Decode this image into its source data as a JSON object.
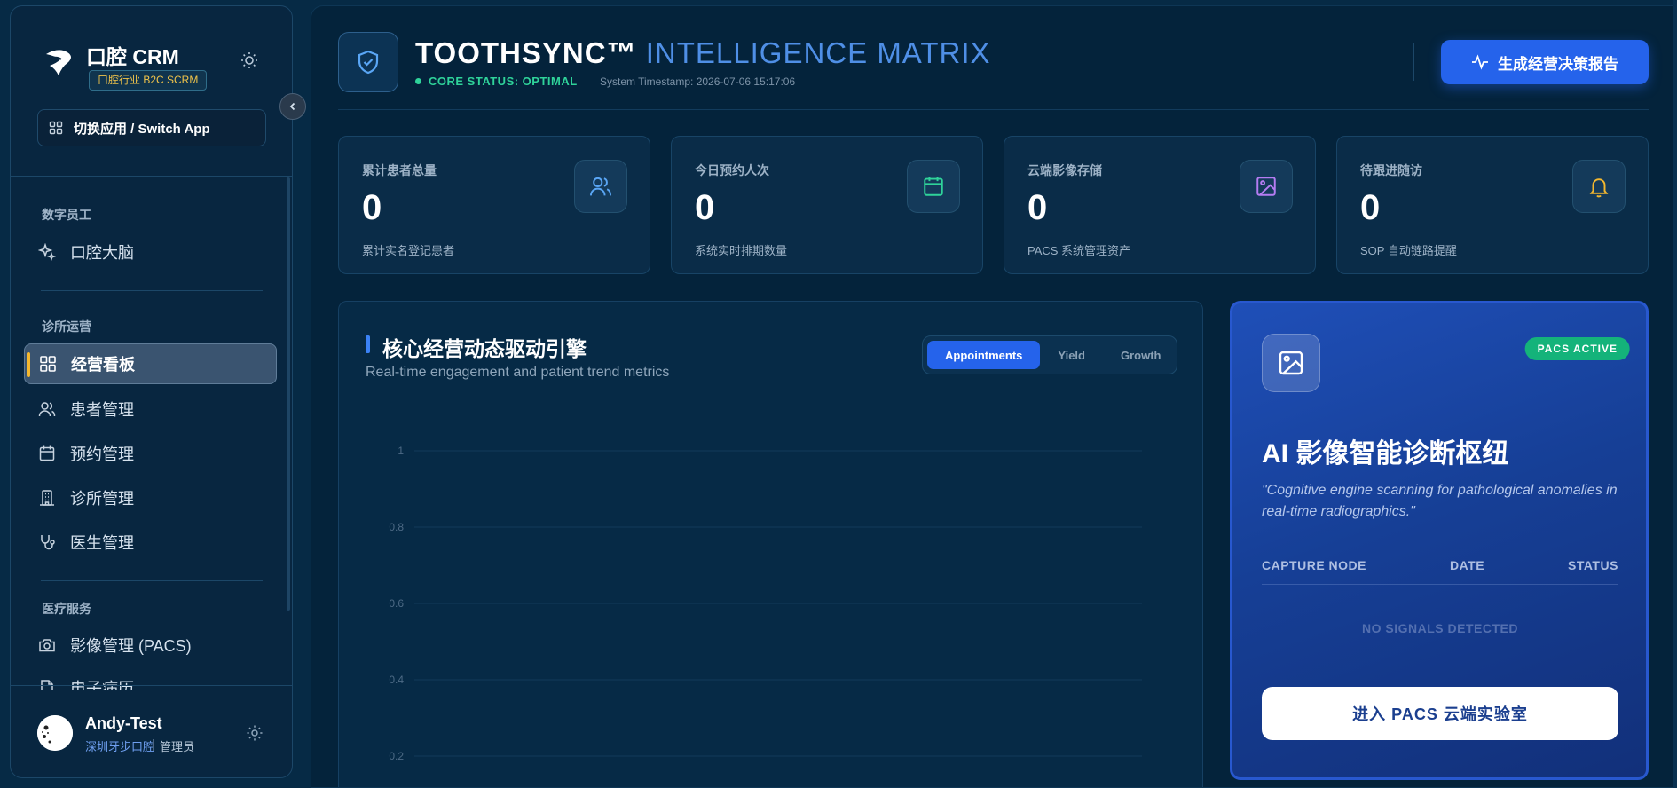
{
  "colors": {
    "accent": "#2563eb",
    "status_green": "#2fd39a",
    "active_marker": "#f5b82e",
    "sidebar_bg": "#082640",
    "main_bg": "#04233b"
  },
  "sidebar": {
    "brand_name": "口腔 CRM",
    "brand_tag": "口腔行业 B2C SCRM",
    "switch_app_label": "切换应用 / Switch App",
    "sections": [
      {
        "title": "数字员工",
        "items": [
          {
            "label": "口腔大脑",
            "icon": "sparkles-icon"
          }
        ]
      },
      {
        "title": "诊所运营",
        "items": [
          {
            "label": "经营看板",
            "icon": "dashboard-icon",
            "active": true
          },
          {
            "label": "患者管理",
            "icon": "users-icon"
          },
          {
            "label": "预约管理",
            "icon": "calendar-icon"
          },
          {
            "label": "诊所管理",
            "icon": "building-icon"
          },
          {
            "label": "医生管理",
            "icon": "stethoscope-icon"
          }
        ]
      },
      {
        "title": "医疗服务",
        "items": [
          {
            "label": "影像管理 (PACS)",
            "icon": "camera-icon"
          },
          {
            "label": "电子病历",
            "icon": "file-icon"
          }
        ]
      }
    ],
    "user": {
      "name": "Andy-Test",
      "org": "深圳牙步口腔",
      "role": "管理员"
    }
  },
  "header": {
    "title_main": "TOOTHSYNC™",
    "title_accent": "INTELLIGENCE MATRIX",
    "status": "CORE STATUS: OPTIMAL",
    "timestamp": "System Timestamp: 2026-07-06 15:17:06",
    "report_button": "生成经营决策报告"
  },
  "stats": [
    {
      "label": "累计患者总量",
      "value": "0",
      "sub": "累计实名登记患者",
      "icon": "users-icon",
      "color": "#5aa6f5"
    },
    {
      "label": "今日预约人次",
      "value": "0",
      "sub": "系统实时排期数量",
      "icon": "calendar-icon",
      "color": "#2fd39a"
    },
    {
      "label": "云端影像存储",
      "value": "0",
      "sub": "PACS 系统管理资产",
      "icon": "image-icon",
      "color": "#b57cf2"
    },
    {
      "label": "待跟进随访",
      "value": "0",
      "sub": "SOP 自动链路提醒",
      "icon": "bell-icon",
      "color": "#f5b82e"
    }
  ],
  "chart_panel": {
    "title": "核心经营动态驱动引擎",
    "subtitle": "Real-time engagement and patient trend metrics",
    "tabs": [
      {
        "label": "Appointments",
        "active": true
      },
      {
        "label": "Yield",
        "active": false
      },
      {
        "label": "Growth",
        "active": false
      }
    ]
  },
  "chart_data": {
    "type": "line",
    "title": "",
    "xlabel": "",
    "ylabel": "",
    "ylim": [
      0,
      1
    ],
    "yticks": [
      1,
      0.8,
      0.6,
      0.4,
      0.2
    ],
    "grid": true,
    "series": []
  },
  "pacs": {
    "badge": "PACS ACTIVE",
    "title": "AI 影像智能诊断枢纽",
    "description": "\"Cognitive engine scanning for pathological anomalies in real-time radiographics.\"",
    "columns": [
      "CAPTURE NODE",
      "DATE",
      "STATUS"
    ],
    "empty_text": "NO SIGNALS DETECTED",
    "button": "进入 PACS 云端实验室"
  }
}
